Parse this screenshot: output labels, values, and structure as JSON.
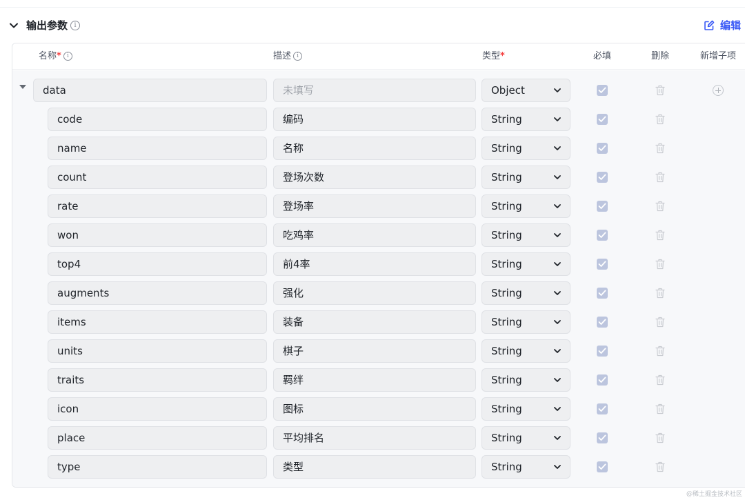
{
  "section": {
    "title": "输出参数",
    "info": "i",
    "edit_label": "编辑"
  },
  "columns": {
    "name": "名称",
    "name_required": "*",
    "name_info": "i",
    "desc": "描述",
    "desc_info": "i",
    "type": "类型",
    "type_required": "*",
    "required": "必填",
    "delete": "删除",
    "add_child": "新增子项"
  },
  "root_row": {
    "name": "data",
    "desc_placeholder": "未填写",
    "type": "Object",
    "required": true
  },
  "rows": [
    {
      "name": "code",
      "desc": "编码",
      "type": "String",
      "required": true
    },
    {
      "name": "name",
      "desc": "名称",
      "type": "String",
      "required": true
    },
    {
      "name": "count",
      "desc": "登场次数",
      "type": "String",
      "required": true
    },
    {
      "name": "rate",
      "desc": "登场率",
      "type": "String",
      "required": true
    },
    {
      "name": "won",
      "desc": "吃鸡率",
      "type": "String",
      "required": true
    },
    {
      "name": "top4",
      "desc": "前4率",
      "type": "String",
      "required": true
    },
    {
      "name": "augments",
      "desc": "强化",
      "type": "String",
      "required": true
    },
    {
      "name": "items",
      "desc": "装备",
      "type": "String",
      "required": true
    },
    {
      "name": "units",
      "desc": "棋子",
      "type": "String",
      "required": true
    },
    {
      "name": "traits",
      "desc": "羁绊",
      "type": "String",
      "required": true
    },
    {
      "name": "icon",
      "desc": "图标",
      "type": "String",
      "required": true
    },
    {
      "name": "place",
      "desc": "平均排名",
      "type": "String",
      "required": true
    },
    {
      "name": "type",
      "desc": "类型",
      "type": "String",
      "required": true
    }
  ],
  "watermark": "@稀土掘金技术社区",
  "colors": {
    "accent": "#3858f6",
    "required_star": "#f53f3f",
    "checkbox": "#bcc5de"
  }
}
